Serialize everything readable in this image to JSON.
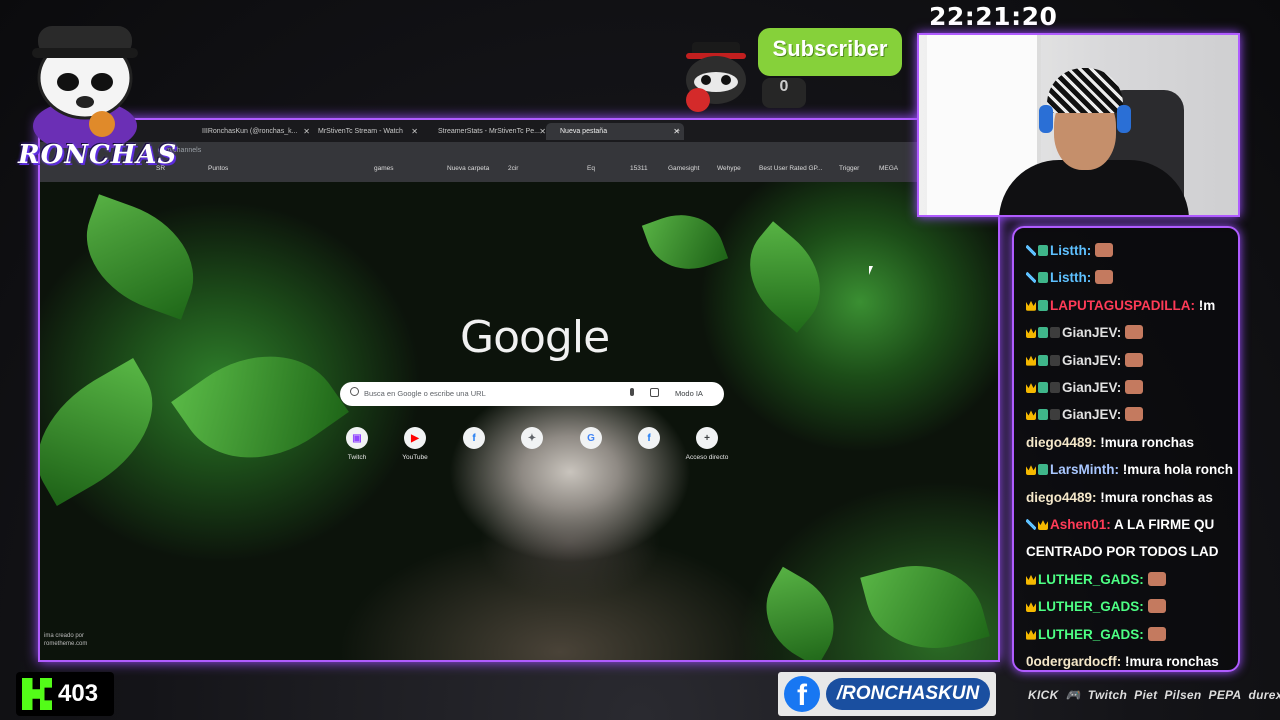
{
  "clock": "22:21:20",
  "logo": {
    "text": "RONCHAS"
  },
  "subscriber": {
    "label": "Subscriber",
    "count": "0"
  },
  "browser": {
    "tabs": [
      {
        "label": "IIIRonchasKun (@ronchas_k..."
      },
      {
        "label": "MrStivenTc Stream - Watch"
      },
      {
        "label": "StreamerStats - MrStivenTc Pe..."
      },
      {
        "label": "Nueva pestaña"
      }
    ],
    "url_fragment": "com/channels",
    "bookmarks": [
      "SR",
      "Puntos",
      "games",
      "Nueva carpeta",
      "2cir",
      "Eq",
      "15311",
      "Gamesight",
      "Wehype",
      "Best User Rated GP...",
      "Trigger",
      "MEGA"
    ],
    "google_logo": "Google",
    "search_placeholder": "Busca en Google o escribe una URL",
    "ai_mode": "Modo IA",
    "shortcuts": [
      {
        "label": "Twitch",
        "icon": "twitch-icon",
        "glyph": "▣",
        "color": "#9146ff"
      },
      {
        "label": "YouTube",
        "icon": "youtube-icon",
        "glyph": "▶",
        "color": "#ff0000"
      },
      {
        "label": "",
        "icon": "facebook-icon",
        "glyph": "f",
        "color": "#1877f2"
      },
      {
        "label": "",
        "icon": "link-icon",
        "glyph": "✦",
        "color": "#5f6368"
      },
      {
        "label": "",
        "icon": "translate-icon",
        "glyph": "G",
        "color": "#4285f4"
      },
      {
        "label": "",
        "icon": "facebook-icon",
        "glyph": "f",
        "color": "#1877f2"
      },
      {
        "label": "Acceso directo",
        "icon": "plus-icon",
        "glyph": "+",
        "color": "#3c4043"
      }
    ],
    "credit_line1": "ima creado por",
    "credit_line2": "rometheme.com"
  },
  "chat": [
    {
      "badges": [
        "sword",
        "88"
      ],
      "user": "Listth:",
      "color": "#5ec1ff",
      "text": "",
      "emote": true
    },
    {
      "badges": [
        "sword",
        "88"
      ],
      "user": "Listth:",
      "color": "#5ec1ff",
      "text": "",
      "emote": true
    },
    {
      "badges": [
        "crown",
        "88"
      ],
      "user": "LAPUTAGUSPADILLA:",
      "color": "#ff3b57",
      "text": " !m",
      "emote": false
    },
    {
      "badges": [
        "crown",
        "88",
        "sub"
      ],
      "user": "GianJEV:",
      "color": "#e0e0e0",
      "text": "",
      "emote": true
    },
    {
      "badges": [
        "crown",
        "88",
        "sub"
      ],
      "user": "GianJEV:",
      "color": "#e0e0e0",
      "text": "",
      "emote": true
    },
    {
      "badges": [
        "crown",
        "88",
        "sub"
      ],
      "user": "GianJEV:",
      "color": "#e0e0e0",
      "text": "",
      "emote": true
    },
    {
      "badges": [
        "crown",
        "88",
        "sub"
      ],
      "user": "GianJEV:",
      "color": "#e0e0e0",
      "text": "",
      "emote": true
    },
    {
      "badges": [],
      "user": "diego4489:",
      "color": "#f4e7c9",
      "text": " !mura ronchas",
      "emote": false
    },
    {
      "badges": [
        "crown",
        "88"
      ],
      "user": "LarsMinth:",
      "color": "#a9c7ff",
      "text": " !mura hola ronch",
      "emote": false
    },
    {
      "badges": [],
      "user": "diego4489:",
      "color": "#f4e7c9",
      "text": " !mura ronchas as",
      "emote": false
    },
    {
      "badges": [
        "sword",
        "crown"
      ],
      "user": "Ashen01:",
      "color": "#ff3b57",
      "text": " A LA FIRME QU",
      "emote": false
    },
    {
      "badges": [],
      "user": "",
      "color": "#ffffff",
      "text": "CENTRADO POR TODOS LAD",
      "emote": false
    },
    {
      "badges": [
        "crown"
      ],
      "user": "LUTHER_GADS:",
      "color": "#4dff84",
      "text": "",
      "emote": true
    },
    {
      "badges": [
        "crown"
      ],
      "user": "LUTHER_GADS:",
      "color": "#4dff84",
      "text": "",
      "emote": true
    },
    {
      "badges": [
        "crown"
      ],
      "user": "LUTHER_GADS:",
      "color": "#4dff84",
      "text": "",
      "emote": true
    },
    {
      "badges": [],
      "user": "0odergardocff:",
      "color": "#f4e7c9",
      "text": " !mura ronchas",
      "emote": false
    }
  ],
  "kick": {
    "count": "403"
  },
  "facebook": {
    "handle": "/RONCHASKUN"
  },
  "sponsors": [
    "KICK",
    "🎮",
    "Twitch",
    "Piet",
    "Pilsen",
    "PEPA",
    "durex"
  ]
}
